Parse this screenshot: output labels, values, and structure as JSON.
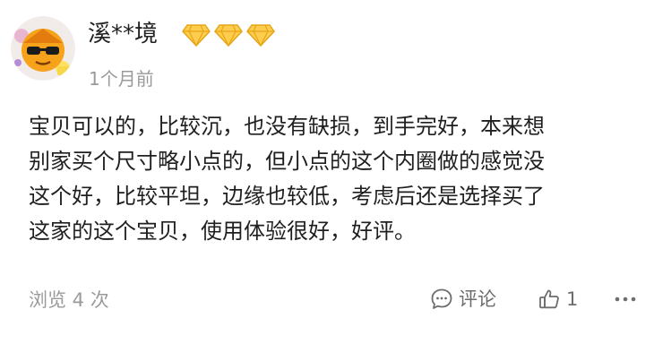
{
  "user": {
    "name": "溪**境",
    "avatar_icon": "cartoon-sunglasses-avatar-icon",
    "badge_icons": [
      "diamond-icon",
      "diamond-icon",
      "diamond-icon"
    ],
    "badge_color": "#FFC94A",
    "post_time": "1个月前"
  },
  "review": {
    "text": "宝贝可以的，比较沉，也没有缺损，到手完好，本来想\n别家买个尺寸略小点的，但小点的这个内圈做的感觉没\n这个好，比较平坦，边缘也较低，考虑后还是选择买了\n这家的这个宝贝，使用体验很好，好评。"
  },
  "footer": {
    "views": "浏览 4 次",
    "comment_label": "评论",
    "comment_icon": "comment-bubble-icon",
    "like_count": "1",
    "like_icon": "thumbs-up-icon",
    "more_icon": "more-dots-icon"
  }
}
